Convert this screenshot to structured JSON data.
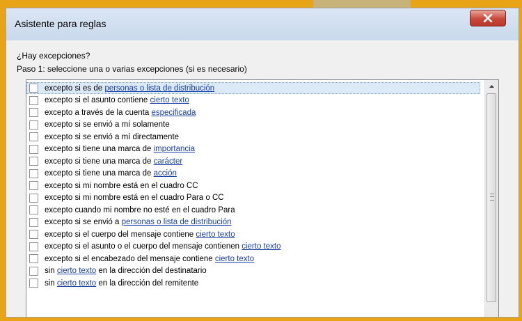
{
  "window": {
    "title": "Asistente para reglas",
    "close_icon": "close-icon"
  },
  "prompt": {
    "question": "¿Hay excepciones?",
    "step": "Paso 1: seleccione una o varias excepciones (si es necesario)"
  },
  "exceptions": [
    {
      "checked": false,
      "selected": true,
      "parts": [
        {
          "t": "excepto si es de "
        },
        {
          "t": "personas o lista de distribución",
          "link": true
        }
      ]
    },
    {
      "checked": false,
      "parts": [
        {
          "t": "excepto si el asunto contiene "
        },
        {
          "t": "cierto texto",
          "link": true
        }
      ]
    },
    {
      "checked": false,
      "parts": [
        {
          "t": "excepto a través de la cuenta "
        },
        {
          "t": "especificada",
          "link": true
        }
      ]
    },
    {
      "checked": false,
      "parts": [
        {
          "t": "excepto si se envió a mí solamente"
        }
      ]
    },
    {
      "checked": false,
      "parts": [
        {
          "t": "excepto si se envió a mí directamente"
        }
      ]
    },
    {
      "checked": false,
      "parts": [
        {
          "t": "excepto si tiene una marca de "
        },
        {
          "t": "importancia",
          "link": true
        }
      ]
    },
    {
      "checked": false,
      "parts": [
        {
          "t": "excepto si tiene una marca de "
        },
        {
          "t": "carácter",
          "link": true
        }
      ]
    },
    {
      "checked": false,
      "parts": [
        {
          "t": "excepto si tiene una marca de "
        },
        {
          "t": "acción",
          "link": true
        }
      ]
    },
    {
      "checked": false,
      "parts": [
        {
          "t": "excepto si mi nombre está en el cuadro CC"
        }
      ]
    },
    {
      "checked": false,
      "parts": [
        {
          "t": "excepto si mi nombre está en el cuadro Para o CC"
        }
      ]
    },
    {
      "checked": false,
      "parts": [
        {
          "t": "excepto cuando mi nombre no esté en el cuadro Para"
        }
      ]
    },
    {
      "checked": false,
      "parts": [
        {
          "t": "excepto si se envió a "
        },
        {
          "t": "personas o lista de distribución",
          "link": true
        }
      ]
    },
    {
      "checked": false,
      "parts": [
        {
          "t": "excepto si el cuerpo del mensaje contiene "
        },
        {
          "t": "cierto texto",
          "link": true
        }
      ]
    },
    {
      "checked": false,
      "parts": [
        {
          "t": "excepto si el asunto o el cuerpo del mensaje contienen "
        },
        {
          "t": "cierto texto",
          "link": true
        }
      ]
    },
    {
      "checked": false,
      "parts": [
        {
          "t": "excepto si el encabezado del mensaje contiene "
        },
        {
          "t": "cierto texto",
          "link": true
        }
      ]
    },
    {
      "checked": false,
      "parts": [
        {
          "t": "sin "
        },
        {
          "t": "cierto texto",
          "link": true
        },
        {
          "t": " en la dirección del destinatario"
        }
      ]
    },
    {
      "checked": false,
      "parts": [
        {
          "t": "sin "
        },
        {
          "t": "cierto texto",
          "link": true
        },
        {
          "t": " en la dirección del remitente"
        }
      ]
    }
  ],
  "colors": {
    "frame": "#e8a317",
    "link": "#1a3fa8",
    "close": "#c9483a"
  }
}
